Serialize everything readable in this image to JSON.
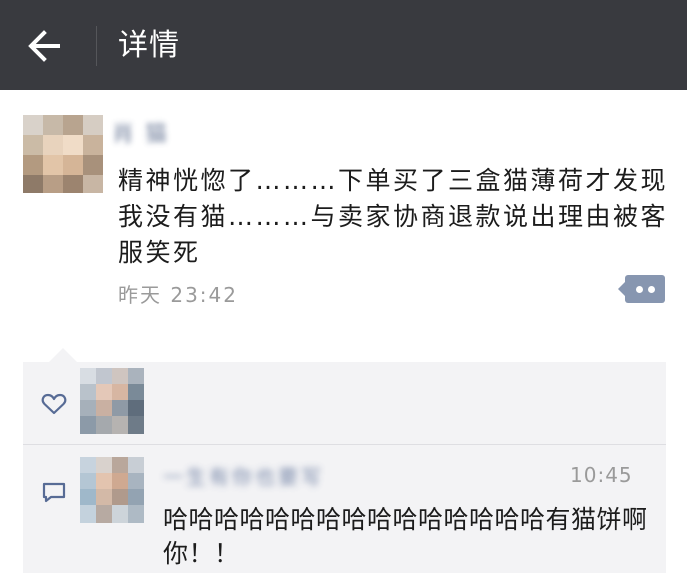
{
  "header": {
    "title": "详情",
    "back_icon": "arrow-left-icon"
  },
  "post": {
    "author_name": "肖 猫",
    "text": "精神恍惚了………下单买了三盒猫薄荷才发现我没有猫………与卖家协商退款说出理由被客服笑死",
    "time": "昨天 23:42",
    "comment_toggle_icon": "more-dots-icon"
  },
  "interactions": {
    "like_icon": "heart-icon",
    "comment_icon": "comment-bubble-icon"
  },
  "comment": {
    "author_name": "一生有你也要写",
    "time": "10:45",
    "text": "哈哈哈哈哈哈哈哈哈哈哈哈哈哈哈有猫饼啊你！！"
  },
  "colors": {
    "topbar": "#393a3f",
    "link_blue": "#576b95",
    "panel_bg": "#f3f3f5"
  }
}
